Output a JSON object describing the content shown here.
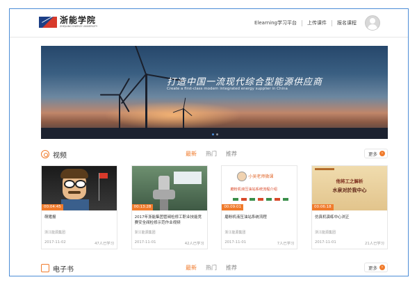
{
  "logo": {
    "name_cn": "浙能学院",
    "name_en": "ZHEJIANG ENERGY UNIVERSITY"
  },
  "nav": {
    "items": [
      "Elearning学习平台",
      "上传课件",
      "报名课程"
    ]
  },
  "banner": {
    "title": "打造中国一流现代综合型能源供应商",
    "subtitle": "Create a first-class modern integrated energy supplier in China",
    "slide_count": 2,
    "active_slide": 0
  },
  "videos": {
    "title": "视频",
    "tabs": [
      "最新",
      "热门",
      "推荐"
    ],
    "active_tab": 0,
    "more_label": "更多",
    "cards": [
      {
        "duration": "00:04:45",
        "title": "萌猪报",
        "org": "浙江能源集团",
        "date": "2017-11-02",
        "learners": "47人已学习",
        "thumb": "cartoon"
      },
      {
        "duration": "00:13:28",
        "title": "2017年浙能集团管阀检修工职业技能竞赛安全阀检修示范作业视频",
        "org": "浙江能源集团",
        "date": "2017-11-01",
        "learners": "42人已学习",
        "thumb": "valve"
      },
      {
        "duration": "00:09:01",
        "title": "磨粉机液压油站系统流程",
        "org": "浙江能源集团",
        "date": "2017-11-01",
        "learners": "7人已学习",
        "thumb": "slide",
        "thumb_heading": "小吴老师微课",
        "thumb_text": "磨粉机液压油站系统流程介绍"
      },
      {
        "duration": "00:06:18",
        "title": "仿真机演练中心浏正",
        "org": "浙江能源集团",
        "date": "2017-11-01",
        "learners": "21人已学习",
        "thumb": "calligraphy",
        "thumb_line1": "他将工之解析",
        "thumb_line2": "水泉对於我中心"
      }
    ]
  },
  "ebooks": {
    "title": "电子书",
    "tabs": [
      "最新",
      "热门",
      "推荐"
    ],
    "active_tab": 0,
    "more_label": "更多"
  },
  "colors": {
    "accent": "#f07b2c",
    "frame": "#4b8cd6"
  }
}
